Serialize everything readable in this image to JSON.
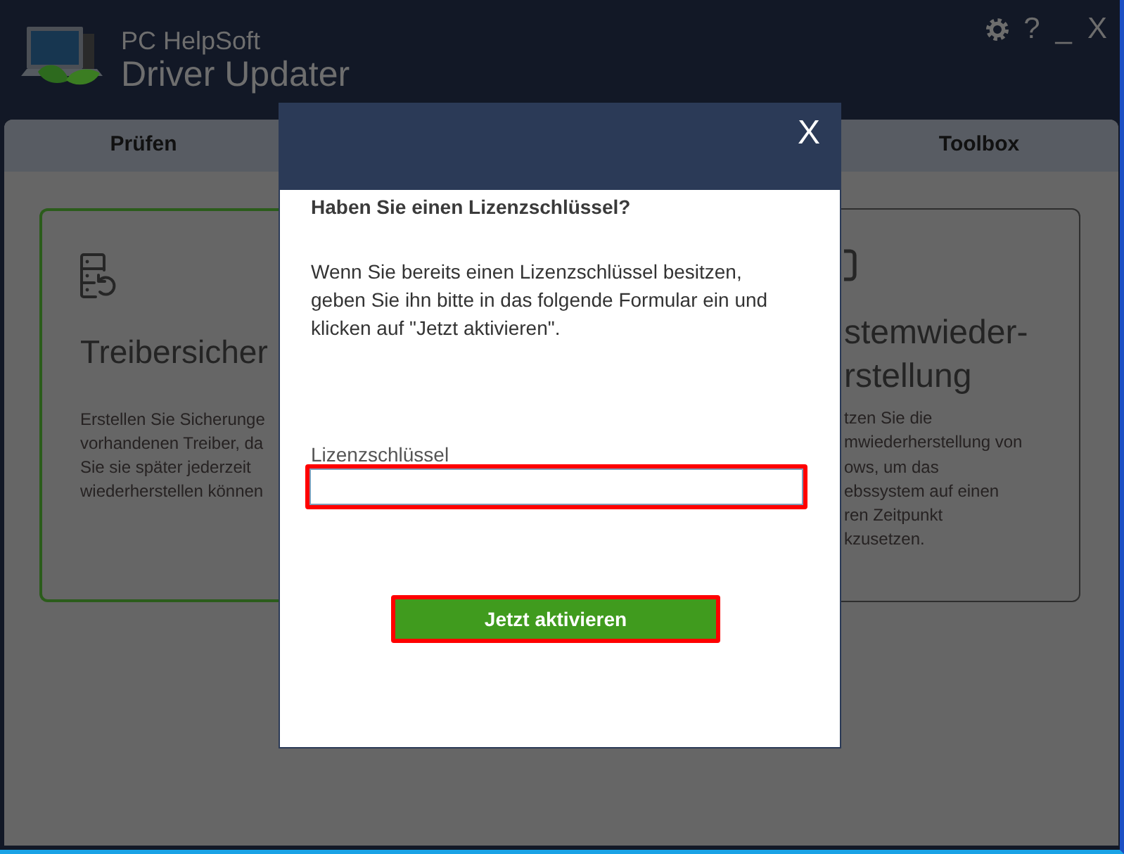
{
  "app": {
    "brand": "PC HelpSoft",
    "product": "Driver Updater",
    "window_controls": {
      "help": "?",
      "minimize": "_",
      "close": "X"
    }
  },
  "tabs": [
    {
      "label": "Prüfen"
    },
    {
      "label": "Toolbox"
    }
  ],
  "cards": [
    {
      "kind": "backup",
      "selected": true,
      "title_lines": [
        "Treibersicher"
      ],
      "description_lines": [
        "Erstellen Sie Sicherunge",
        "vorhandenen Treiber, da",
        "Sie sie später jederzeit",
        "wiederherstellen können"
      ]
    },
    {
      "kind": "restore",
      "selected": false,
      "title_lines": [
        "stemwieder-",
        "rstellung"
      ],
      "description_lines": [
        "tzen Sie die",
        "mwiederherstellung von",
        "ows, um das",
        "ebssystem auf einen",
        "ren Zeitpunkt",
        "kzusetzen."
      ]
    }
  ],
  "dialog": {
    "close": "X",
    "title": "Haben Sie einen Lizenzschlüssel?",
    "message": "Wenn Sie bereits einen Lizenzschlüssel besitzen, geben Sie ihn bitte in das folgende Formular ein und klicken auf \"Jetzt aktivieren\".",
    "license_field": {
      "label": "Lizenzschlüssel",
      "highlighted": true
    },
    "activate_button": {
      "label": "Jetzt aktivieren",
      "highlighted": true
    }
  }
}
